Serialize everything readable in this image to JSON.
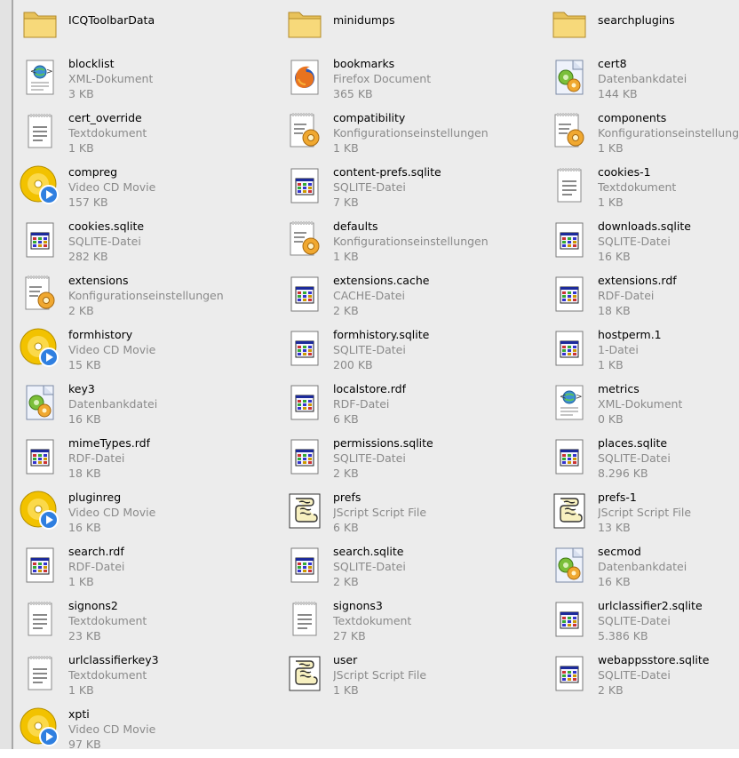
{
  "files": [
    {
      "name": "ICQToolbarData",
      "kind": "folder",
      "icon": "folder-icon"
    },
    {
      "name": "minidumps",
      "kind": "folder",
      "icon": "folder-icon"
    },
    {
      "name": "searchplugins",
      "kind": "folder",
      "icon": "folder-icon"
    },
    {
      "name": "blocklist",
      "type": "XML-Dokument",
      "size": "3 KB",
      "icon": "xml-document-icon"
    },
    {
      "name": "bookmarks",
      "type": "Firefox Document",
      "size": "365 KB",
      "icon": "firefox-document-icon"
    },
    {
      "name": "cert8",
      "type": "Datenbankdatei",
      "size": "144 KB",
      "icon": "database-file-icon"
    },
    {
      "name": "cert_override",
      "type": "Textdokument",
      "size": "1 KB",
      "icon": "text-document-icon"
    },
    {
      "name": "compatibility",
      "type": "Konfigurationseinstellungen",
      "size": "1 KB",
      "icon": "config-settings-icon"
    },
    {
      "name": "components",
      "type": "Konfigurationseinstellungen",
      "size": "1 KB",
      "icon": "config-settings-icon"
    },
    {
      "name": "compreg",
      "type": "Video CD Movie",
      "size": "157 KB",
      "icon": "video-cd-icon"
    },
    {
      "name": "content-prefs.sqlite",
      "type": "SQLITE-Datei",
      "size": "7 KB",
      "icon": "generic-file-icon"
    },
    {
      "name": "cookies-1",
      "type": "Textdokument",
      "size": "1 KB",
      "icon": "text-document-icon"
    },
    {
      "name": "cookies.sqlite",
      "type": "SQLITE-Datei",
      "size": "282 KB",
      "icon": "generic-file-icon"
    },
    {
      "name": "defaults",
      "type": "Konfigurationseinstellungen",
      "size": "1 KB",
      "icon": "config-settings-icon"
    },
    {
      "name": "downloads.sqlite",
      "type": "SQLITE-Datei",
      "size": "16 KB",
      "icon": "generic-file-icon"
    },
    {
      "name": "extensions",
      "type": "Konfigurationseinstellungen",
      "size": "2 KB",
      "icon": "config-settings-icon"
    },
    {
      "name": "extensions.cache",
      "type": "CACHE-Datei",
      "size": "2 KB",
      "icon": "generic-file-icon"
    },
    {
      "name": "extensions.rdf",
      "type": "RDF-Datei",
      "size": "18 KB",
      "icon": "generic-file-icon"
    },
    {
      "name": "formhistory",
      "type": "Video CD Movie",
      "size": "15 KB",
      "icon": "video-cd-icon"
    },
    {
      "name": "formhistory.sqlite",
      "type": "SQLITE-Datei",
      "size": "200 KB",
      "icon": "generic-file-icon"
    },
    {
      "name": "hostperm.1",
      "type": "1-Datei",
      "size": "1 KB",
      "icon": "generic-file-icon"
    },
    {
      "name": "key3",
      "type": "Datenbankdatei",
      "size": "16 KB",
      "icon": "database-file-icon"
    },
    {
      "name": "localstore.rdf",
      "type": "RDF-Datei",
      "size": "6 KB",
      "icon": "generic-file-icon"
    },
    {
      "name": "metrics",
      "type": "XML-Dokument",
      "size": "0 KB",
      "icon": "xml-document-icon"
    },
    {
      "name": "mimeTypes.rdf",
      "type": "RDF-Datei",
      "size": "18 KB",
      "icon": "generic-file-icon"
    },
    {
      "name": "permissions.sqlite",
      "type": "SQLITE-Datei",
      "size": "2 KB",
      "icon": "generic-file-icon"
    },
    {
      "name": "places.sqlite",
      "type": "SQLITE-Datei",
      "size": "8.296 KB",
      "icon": "generic-file-icon"
    },
    {
      "name": "pluginreg",
      "type": "Video CD Movie",
      "size": "16 KB",
      "icon": "video-cd-icon"
    },
    {
      "name": "prefs",
      "type": "JScript Script File",
      "size": "6 KB",
      "icon": "jscript-file-icon"
    },
    {
      "name": "prefs-1",
      "type": "JScript Script File",
      "size": "13 KB",
      "icon": "jscript-file-icon"
    },
    {
      "name": "search.rdf",
      "type": "RDF-Datei",
      "size": "1 KB",
      "icon": "generic-file-icon"
    },
    {
      "name": "search.sqlite",
      "type": "SQLITE-Datei",
      "size": "2 KB",
      "icon": "generic-file-icon"
    },
    {
      "name": "secmod",
      "type": "Datenbankdatei",
      "size": "16 KB",
      "icon": "database-file-icon"
    },
    {
      "name": "signons2",
      "type": "Textdokument",
      "size": "23 KB",
      "icon": "text-document-icon"
    },
    {
      "name": "signons3",
      "type": "Textdokument",
      "size": "27 KB",
      "icon": "text-document-icon"
    },
    {
      "name": "urlclassifier2.sqlite",
      "type": "SQLITE-Datei",
      "size": "5.386 KB",
      "icon": "generic-file-icon"
    },
    {
      "name": "urlclassifierkey3",
      "type": "Textdokument",
      "size": "1 KB",
      "icon": "text-document-icon"
    },
    {
      "name": "user",
      "type": "JScript Script File",
      "size": "1 KB",
      "icon": "jscript-file-icon"
    },
    {
      "name": "webappsstore.sqlite",
      "type": "SQLITE-Datei",
      "size": "2 KB",
      "icon": "generic-file-icon"
    },
    {
      "name": "xpti",
      "type": "Video CD Movie",
      "size": "97 KB",
      "icon": "video-cd-icon"
    }
  ]
}
